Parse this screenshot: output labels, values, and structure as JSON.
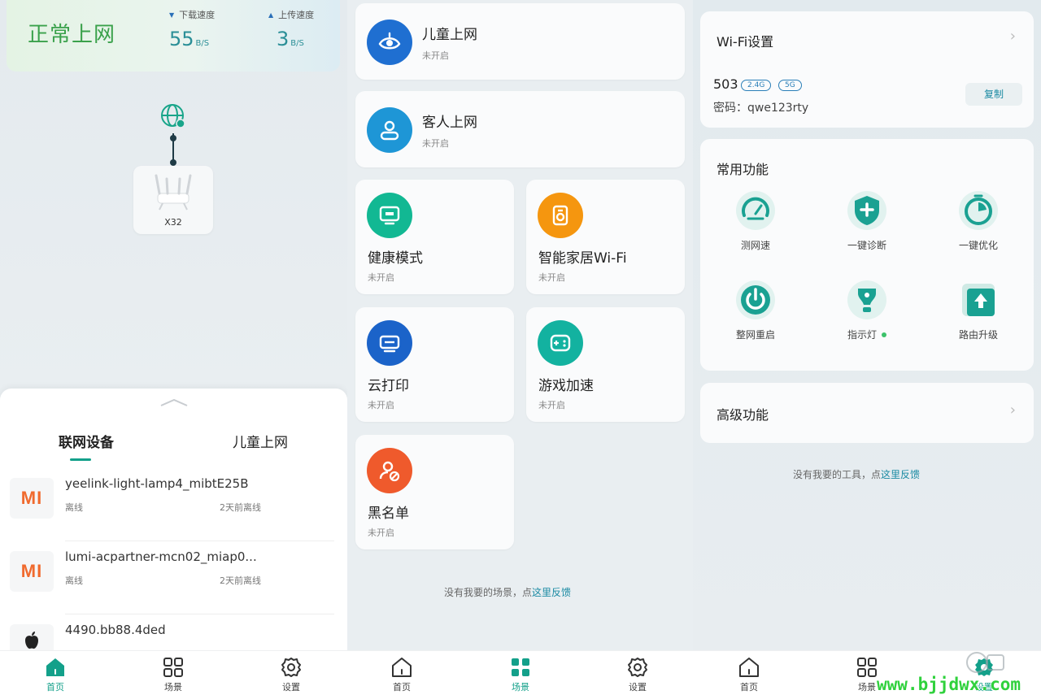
{
  "status": {
    "network_state": "正常上网",
    "download_label": "下载速度",
    "download_value": "55",
    "download_unit": "B/S",
    "upload_label": "上传速度",
    "upload_value": "3",
    "upload_unit": "B/S"
  },
  "topology": {
    "router_name": "X32"
  },
  "devices": {
    "tabs": [
      "联网设备",
      "儿童上网"
    ],
    "list": [
      {
        "name": "yeelink-light-lamp4_mibtE25B",
        "state": "离线",
        "time": "2天前离线",
        "logo": "mi-logo"
      },
      {
        "name": "lumi-acpartner-mcn02_miap0...",
        "state": "离线",
        "time": "2天前离线",
        "logo": "mi-logo"
      },
      {
        "name": "4490.bb88.4ded",
        "logo": "apple-logo"
      }
    ]
  },
  "scenes": {
    "items": [
      {
        "title": "儿童上网",
        "status": "未开启",
        "icon": "child-eye-icon",
        "color": "#1f6fd1"
      },
      {
        "title": "客人上网",
        "status": "未开启",
        "icon": "guest-person-icon",
        "color": "#1e96d6"
      },
      {
        "title": "健康模式",
        "status": "未开启",
        "icon": "monitor-icon",
        "color": "#12b893"
      },
      {
        "title": "智能家居Wi-Fi",
        "status": "未开启",
        "icon": "smart-home-icon",
        "color": "#f5960f"
      },
      {
        "title": "云打印",
        "status": "未开启",
        "icon": "printer-icon",
        "color": "#1b63c9"
      },
      {
        "title": "游戏加速",
        "status": "未开启",
        "icon": "gamepad-icon",
        "color": "#13b2a0"
      },
      {
        "title": "黑名单",
        "status": "未开启",
        "icon": "blocked-user-icon",
        "color": "#ef5a2c"
      }
    ],
    "feedback_text": "没有我要的场景，点",
    "feedback_link": "这里反馈"
  },
  "wifi": {
    "title": "Wi-Fi设置",
    "ssid": "503",
    "band_24": "2.4G",
    "band_5": "5G",
    "password_label": "密码：",
    "password": "qwe123rty",
    "copy_label": "复制"
  },
  "common": {
    "title": "常用功能",
    "items": [
      {
        "label": "测网速",
        "icon": "speedometer-icon"
      },
      {
        "label": "一键诊断",
        "icon": "shield-plus-icon"
      },
      {
        "label": "一键优化",
        "icon": "optimize-icon"
      },
      {
        "label": "整网重启",
        "icon": "power-icon"
      },
      {
        "label": "指示灯",
        "icon": "bulb-icon"
      },
      {
        "label": "路由升级",
        "icon": "upgrade-icon"
      }
    ]
  },
  "advanced": {
    "title": "高级功能"
  },
  "tools_feedback": {
    "text": "没有我要的工具，点",
    "link": "这里反馈"
  },
  "nav": {
    "home": "首页",
    "scene": "场景",
    "settings": "设置"
  },
  "watermark": "www.bjjdwx.com",
  "colors": {
    "accent": "#13a08a",
    "status_green": "#3aa14b",
    "link": "#1a8aa3"
  }
}
